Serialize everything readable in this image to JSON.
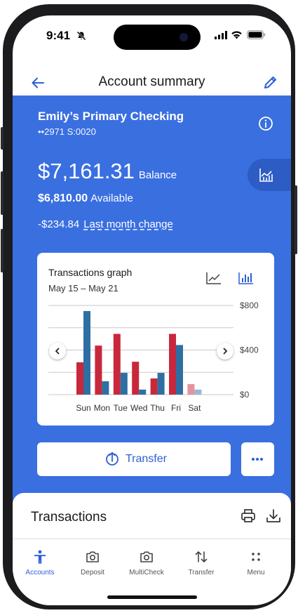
{
  "status_bar": {
    "time": "9:41"
  },
  "header": {
    "title": "Account summary",
    "back_icon": "arrow-left-icon",
    "edit_icon": "pencil-icon"
  },
  "account": {
    "name": "Emily’s Primary Checking",
    "number": "••2971  S:0020",
    "balance": "$7,161.31",
    "balance_label": "Balance",
    "available": "$6,810.00",
    "available_label": "Available",
    "change": "-$234.84",
    "change_label": "Last month change"
  },
  "graph_card": {
    "title": "Transactions graph",
    "range": "May 15 – May 21",
    "line_icon": "line-chart-icon",
    "bar_icon": "bar-chart-icon"
  },
  "chart_data": {
    "type": "bar",
    "categories": [
      "Sun",
      "Mon",
      "Tue",
      "Wed",
      "Thu",
      "Fri",
      "Sat"
    ],
    "series": [
      {
        "values": [
          290,
          440,
          545,
          295,
          145,
          545,
          95
        ],
        "color": "#c8283c",
        "faded_last": "#e394a0"
      },
      {
        "values": [
          750,
          120,
          195,
          45,
          195,
          445,
          45
        ],
        "color": "#2e6fa3",
        "faded_last": "#96b8d3"
      }
    ],
    "ylim": [
      0,
      800
    ],
    "yticks": [
      {
        "value": 0,
        "label": "$0"
      },
      {
        "value": 400,
        "label": "$400"
      },
      {
        "value": 800,
        "label": "$800"
      }
    ],
    "grid": true,
    "legend": "none"
  },
  "actions": {
    "transfer_label": "Transfer",
    "more_label": "•••"
  },
  "transactions": {
    "title": "Transactions"
  },
  "bottom_nav": [
    {
      "label": "Accounts",
      "icon": "person-icon",
      "active": true
    },
    {
      "label": "Deposit",
      "icon": "camera-icon",
      "active": false
    },
    {
      "label": "MultiCheck",
      "icon": "camera-icon",
      "active": false
    },
    {
      "label": "Transfer",
      "icon": "transfer-arrows-icon",
      "active": false
    },
    {
      "label": "Menu",
      "icon": "dots-grid-icon",
      "active": false
    }
  ],
  "colors": {
    "primary_blue": "#3a6fe0",
    "accent_blue": "#2b5fd8",
    "tab_blue": "#2d5cc4"
  }
}
